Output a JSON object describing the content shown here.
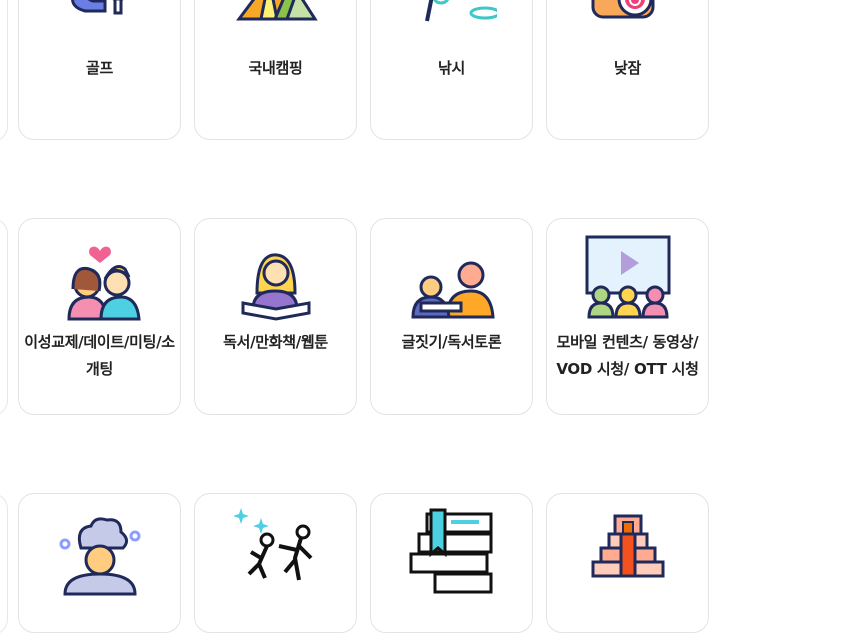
{
  "rows": [
    {
      "items": [
        {
          "label": "골프",
          "icon": "golf-icon"
        },
        {
          "label": "국내캠핑",
          "icon": "camping-tent-icon"
        },
        {
          "label": "낚시",
          "icon": "fishing-icon"
        },
        {
          "label": "낮잠",
          "icon": "nap-alarm-clock-icon"
        }
      ]
    },
    {
      "items": [
        {
          "label": "이성교제/데이트/미팅/소개팅",
          "icon": "couple-dating-icon"
        },
        {
          "label": "독서/만화책/웹툰",
          "icon": "reading-book-icon"
        },
        {
          "label": "글짓기/독서토론",
          "icon": "writing-discussion-icon"
        },
        {
          "label": "모바일 컨텐츠/ 동영상/ VOD 시청/ OTT 시청",
          "icon": "video-screen-audience-icon"
        }
      ]
    },
    {
      "items": [
        {
          "label": "",
          "icon": "sauna-spa-icon"
        },
        {
          "label": "",
          "icon": "dance-jump-icon"
        },
        {
          "label": "",
          "icon": "books-stack-icon"
        },
        {
          "label": "",
          "icon": "pyramid-temple-icon"
        }
      ]
    }
  ]
}
